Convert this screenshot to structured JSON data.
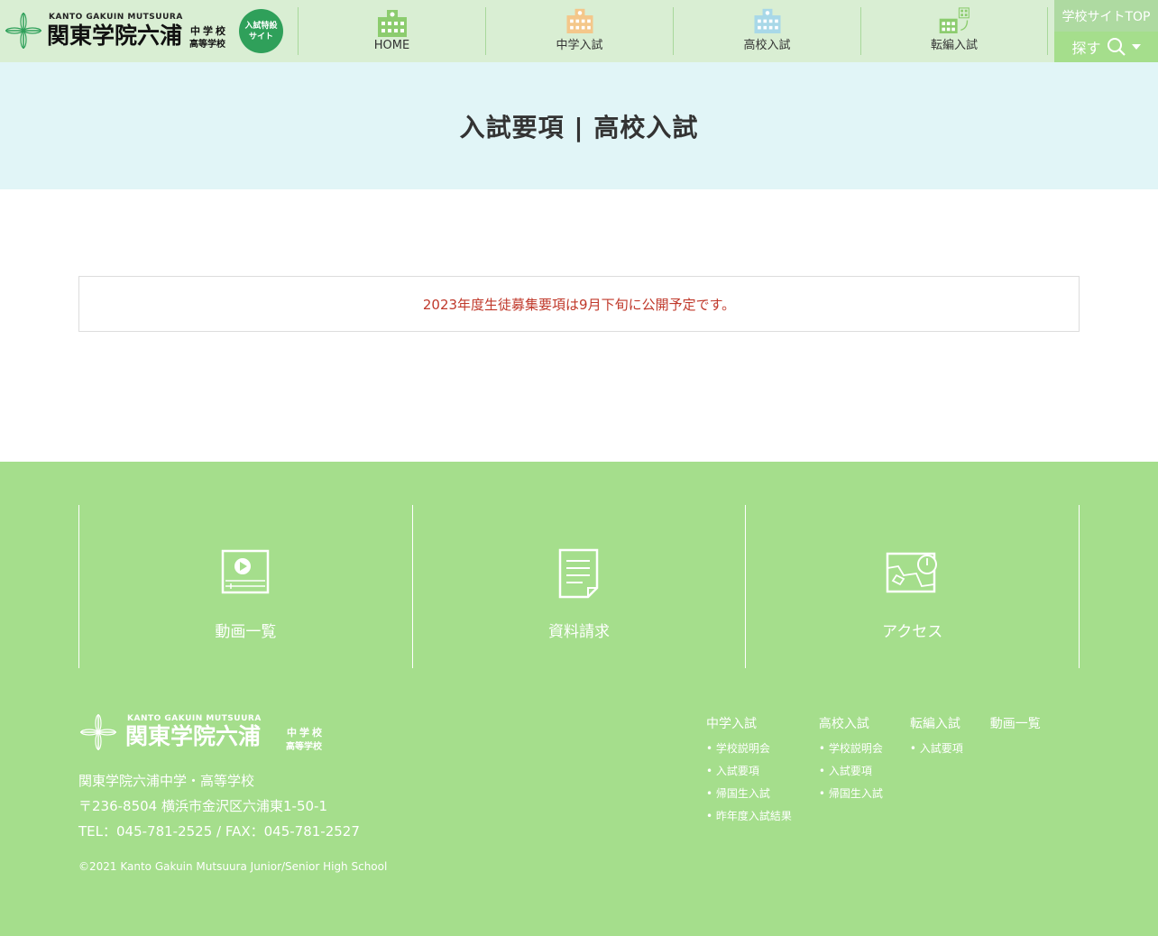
{
  "header": {
    "logo_en": "KANTO GAKUIN MUTSUURA",
    "logo_jp": "関東学院六浦",
    "logo_sub1": "中学校",
    "logo_sub2": "高等学校",
    "badge_line1": "入試特設",
    "badge_line2": "サイト",
    "nav": [
      {
        "label": "HOME",
        "icon": "school-building-icon",
        "color": "#8ccc6e"
      },
      {
        "label": "中学入試",
        "icon": "school-building-icon",
        "color": "#f4c78a"
      },
      {
        "label": "高校入試",
        "icon": "school-building-icon",
        "color": "#a8d8e8"
      },
      {
        "label": "転編入試",
        "icon": "transfer-building-icon",
        "color": "#8ccc6e"
      }
    ],
    "top_link": "学校サイトTOP",
    "search_label": "探す"
  },
  "hero": {
    "title": "入試要項 | 高校入試"
  },
  "notice": {
    "text": "2023年度生徒募集要項は9月下旬に公開予定です。"
  },
  "footer": {
    "quick_links": [
      {
        "label": "動画一覧",
        "icon": "video-icon"
      },
      {
        "label": "資料請求",
        "icon": "document-icon"
      },
      {
        "label": "アクセス",
        "icon": "map-icon"
      }
    ],
    "logo_en": "KANTO GAKUIN MUTSUURA",
    "logo_jp": "関東学院六浦",
    "logo_sub1": "中学校",
    "logo_sub2": "高等学校",
    "school_name": "関東学院六浦中学・高等学校",
    "address": "〒236-8504 横浜市金沢区六浦東1-50-1",
    "tel_fax": "TEL：045-781-2525 / FAX：045-781-2527",
    "copyright": "©2021 Kanto Gakuin Mutsuura Junior/Senior High School",
    "columns": [
      {
        "title": "中学入試",
        "items": [
          "学校説明会",
          "入試要項",
          "帰国生入試",
          "昨年度入試結果"
        ]
      },
      {
        "title": "高校入試",
        "items": [
          "学校説明会",
          "入試要項",
          "帰国生入試"
        ]
      },
      {
        "title": "転編入試",
        "items": [
          "入試要項"
        ]
      },
      {
        "title": "動画一覧",
        "items": []
      }
    ]
  },
  "colors": {
    "header_bg": "#d9eed3",
    "hero_bg": "#e1f5f7",
    "footer_bg": "#a5de8c",
    "badge_green": "#2fa05a",
    "notice_red": "#c0392b"
  }
}
